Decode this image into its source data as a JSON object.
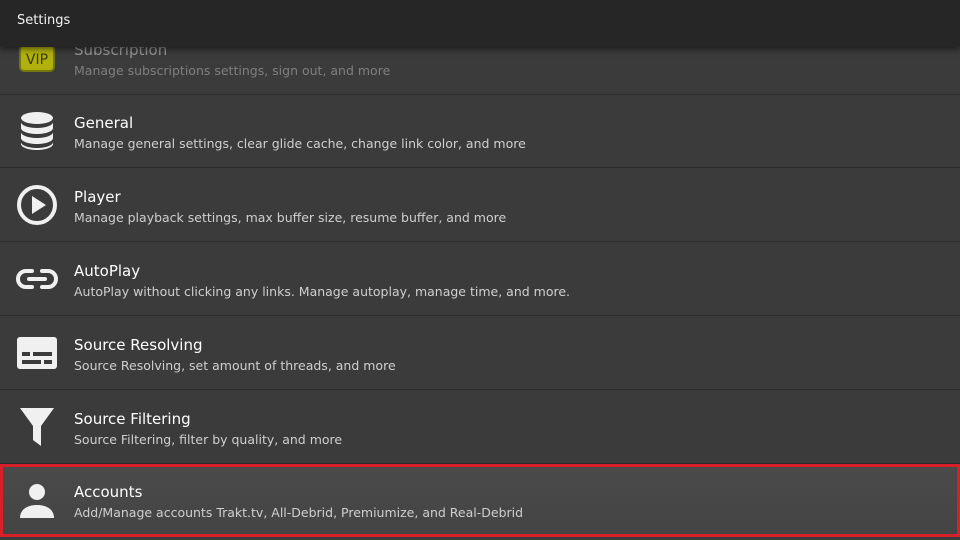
{
  "header": {
    "title": "Settings"
  },
  "items": [
    {
      "icon": "vip-icon",
      "label": "Subscription",
      "desc": "Manage subscriptions settings, sign out, and more"
    },
    {
      "icon": "database-icon",
      "label": "General",
      "desc": "Manage general settings, clear glide cache, change link color, and more"
    },
    {
      "icon": "play-circle-icon",
      "label": "Player",
      "desc": "Manage playback settings, max buffer size, resume buffer, and more"
    },
    {
      "icon": "link-icon",
      "label": "AutoPlay",
      "desc": "AutoPlay without clicking any links. Manage autoplay, manage time, and more."
    },
    {
      "icon": "subtitles-icon",
      "label": "Source Resolving",
      "desc": "Source Resolving, set amount of threads, and more"
    },
    {
      "icon": "filter-icon",
      "label": "Source Filtering",
      "desc": "Source Filtering, filter by quality, and more"
    },
    {
      "icon": "person-icon",
      "label": "Accounts",
      "desc": "Add/Manage accounts Trakt.tv, All-Debrid, Premiumize, and Real-Debrid"
    }
  ],
  "vip_badge_text": "VIP",
  "colors": {
    "background": "#3b3b3b",
    "topbar": "#262626",
    "selection": "#d8202a",
    "vip": "#e6e600"
  }
}
